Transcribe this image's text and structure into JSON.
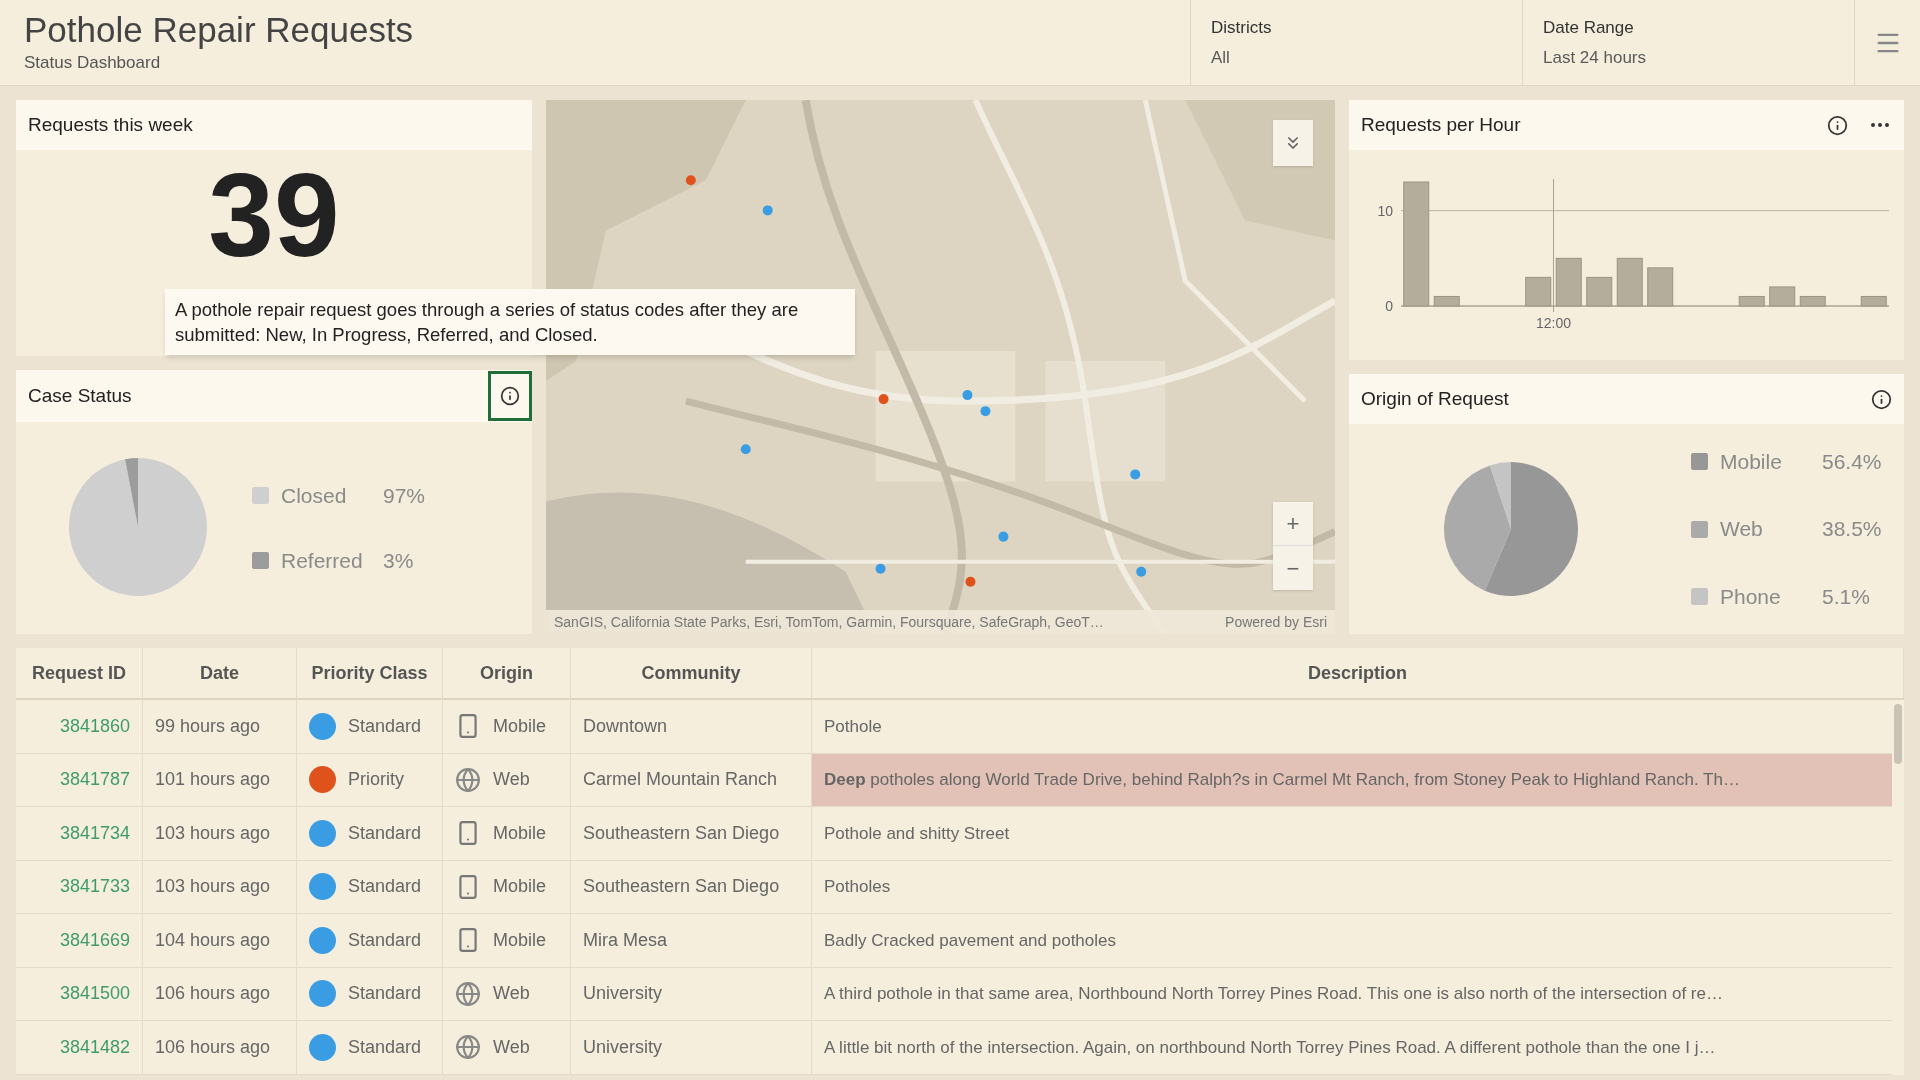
{
  "header": {
    "title": "Pothole Repair Requests",
    "subtitle": "Status Dashboard",
    "filters": [
      {
        "label": "Districts",
        "value": "All"
      },
      {
        "label": "Date Range",
        "value": "Last 24 hours"
      }
    ]
  },
  "requests_week": {
    "title": "Requests this week",
    "value": "39"
  },
  "tooltip": {
    "text": "A pothole repair request goes through a series of status codes after they are submitted: New, In Progress, Referred, and Closed."
  },
  "case_status": {
    "title": "Case Status",
    "info_active": true,
    "chart_data": {
      "type": "pie",
      "categories": [
        "Closed",
        "Referred"
      ],
      "values": [
        97,
        3
      ],
      "colors": [
        "#cfcfcf",
        "#9c9c9c"
      ],
      "value_labels": [
        "97%",
        "3%"
      ]
    }
  },
  "map": {
    "attribution": "SanGIS, California State Parks, Esri, TomTom, Garmin, Foursquare, SafeGraph, GeoT…",
    "powered_by": "Powered by Esri",
    "zoom_in": "+",
    "zoom_out": "−"
  },
  "requests_per_hour": {
    "title": "Requests per Hour",
    "time_marker": "12:00",
    "chart_data": {
      "type": "bar",
      "values": [
        13,
        1,
        0,
        0,
        3,
        5,
        3,
        5,
        4,
        0,
        0,
        1,
        2,
        1,
        0,
        1
      ],
      "ylim": [
        0,
        13
      ],
      "yticks": [
        0,
        10
      ],
      "ref_lines": [
        {
          "axis": "y",
          "value": 10
        }
      ]
    }
  },
  "origin": {
    "title": "Origin of Request",
    "chart_data": {
      "type": "pie",
      "categories": [
        "Mobile",
        "Web",
        "Phone"
      ],
      "values": [
        56.4,
        38.5,
        5.1
      ],
      "colors": [
        "#979797",
        "#aaaaaa",
        "#c4c4c4"
      ],
      "value_labels": [
        "56.4%",
        "38.5%",
        "5.1%"
      ]
    }
  },
  "table": {
    "columns": [
      "Request ID",
      "Date",
      "Priority Class",
      "Origin",
      "Community",
      "Description"
    ],
    "rows": [
      {
        "id": "3841860",
        "date": "99 hours ago",
        "priority": "Standard",
        "color": "#3a9de3",
        "origin": {
          "kind": "mobile",
          "label": "Mobile"
        },
        "community": "Downtown",
        "description": "Pothole",
        "selected": false
      },
      {
        "id": "3841787",
        "date": "101 hours ago",
        "priority": "Priority",
        "color": "#e0521c",
        "origin": {
          "kind": "web",
          "label": "Web"
        },
        "community": "Carmel Mountain Ranch",
        "description": "**Deep** potholes along World Trade Drive, behind Ralph?s in Carmel Mt Ranch, from Stoney Peak to Highland Ranch. Th…",
        "selected": true
      },
      {
        "id": "3841734",
        "date": "103 hours ago",
        "priority": "Standard",
        "color": "#3a9de3",
        "origin": {
          "kind": "mobile",
          "label": "Mobile"
        },
        "community": "Southeastern San Diego",
        "description": "Pothole and shitty Street",
        "selected": false
      },
      {
        "id": "3841733",
        "date": "103 hours ago",
        "priority": "Standard",
        "color": "#3a9de3",
        "origin": {
          "kind": "mobile",
          "label": "Mobile"
        },
        "community": "Southeastern San Diego",
        "description": "Potholes",
        "selected": false
      },
      {
        "id": "3841669",
        "date": "104 hours ago",
        "priority": "Standard",
        "color": "#3a9de3",
        "origin": {
          "kind": "mobile",
          "label": "Mobile"
        },
        "community": "Mira Mesa",
        "description": "Badly Cracked pavement and potholes",
        "selected": false
      },
      {
        "id": "3841500",
        "date": "106 hours ago",
        "priority": "Standard",
        "color": "#3a9de3",
        "origin": {
          "kind": "web",
          "label": "Web"
        },
        "community": "University",
        "description": "A third pothole in that same area, Northbound North Torrey Pines Road. This one is also north of the intersection of re…",
        "selected": false
      },
      {
        "id": "3841482",
        "date": "106 hours ago",
        "priority": "Standard",
        "color": "#3a9de3",
        "origin": {
          "kind": "web",
          "label": "Web"
        },
        "community": "University",
        "description": "A little bit north of the intersection. Again, on northbound North Torrey Pines Road. A different pothole than the one I j…",
        "selected": false
      }
    ]
  }
}
